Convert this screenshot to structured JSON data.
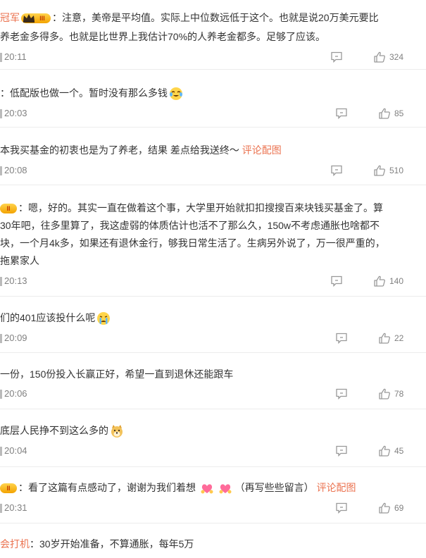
{
  "comments": [
    {
      "name_fragment": "冠军",
      "badge": "III",
      "line1": "：注意，美帝是平均值。实际上中位数远低于这个。也就是说20万美元要比",
      "line2": "养老金多得多。也就是比世界上我估计70%的人养老金都多。足够了应该。",
      "time": "20:11",
      "likes": "324"
    },
    {
      "text": "：低配版也做一个。暂时没有那么多钱",
      "emoji": "crying-laughing-face-icon",
      "time": "20:03",
      "likes": "85"
    },
    {
      "text": "本我买基金的初衷也是为了养老，结果 差点给我送终～",
      "link": "评论配图",
      "time": "20:08",
      "likes": "510"
    },
    {
      "badge": "II",
      "line1": "：嗯，好的。其实一直在做着这个事，大学里开始就扣扣搜搜百来块钱买基金了。算",
      "line2": "30年吧，往多里算了，我这虚弱的体质估计也活不了那么久，150w不考虑通胀也啥都不",
      "line3": "块，一个月4k多，如果还有退休金行，够我日常生活了。生病另外说了，万一很严重的，",
      "line4": "拖累家人",
      "time": "20:13",
      "likes": "140"
    },
    {
      "text": "们的401应该投什么呢",
      "emoji": "crying-face-icon",
      "time": "20:09",
      "likes": "22"
    },
    {
      "text": "一份，150份投入长赢正好，希望一直到退休还能跟车",
      "time": "20:06",
      "likes": "78"
    },
    {
      "text": "底层人民挣不到这么多的",
      "emoji": "doge-icon",
      "time": "20:04",
      "likes": "45"
    },
    {
      "badge": "II",
      "text": "：看了这篇有点感动了，谢谢为我们着想",
      "emoji2": "heart-hands-icon",
      "extra": "（再写些些留言）",
      "link": "评论配图",
      "time": "20:31",
      "likes": "69"
    },
    {
      "name_fragment": "会打机",
      "text": "：30岁开始准备，不算通胀，每年5万"
    }
  ]
}
